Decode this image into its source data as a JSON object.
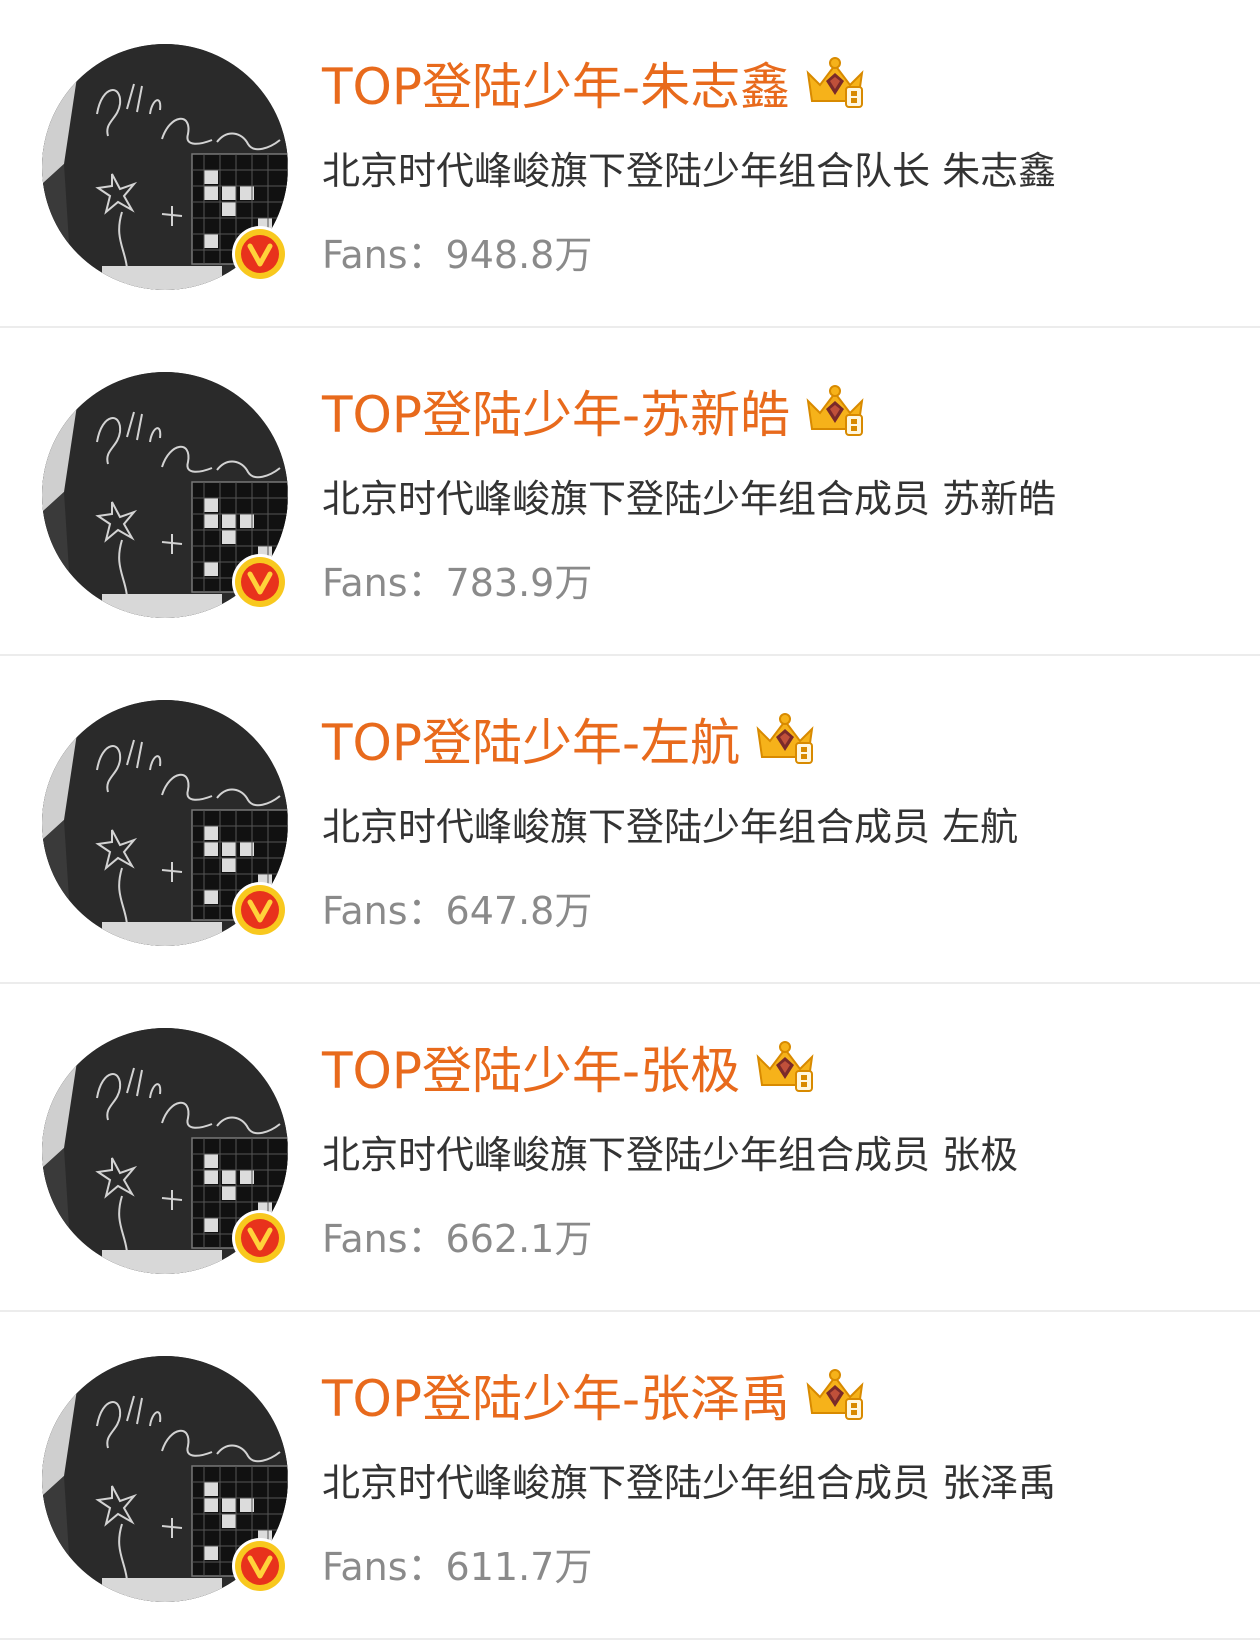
{
  "colors": {
    "name": "#e86a1c",
    "desc": "#333333",
    "fans": "#8a8a8a",
    "divider": "#ececec",
    "badge": "#f5a300"
  },
  "icons": {
    "avatar": "still-alive-album-avatar",
    "verified": "verified-v-badge-icon",
    "crown": "gold-crown-member-icon"
  },
  "accounts": [
    {
      "name": "TOP登陆少年-朱志鑫",
      "desc": "北京时代峰峻旗下登陆少年组合队长 朱志鑫",
      "fans_label": "Fans：",
      "fans_value": "948.8万"
    },
    {
      "name": "TOP登陆少年-苏新皓",
      "desc": "北京时代峰峻旗下登陆少年组合成员 苏新皓",
      "fans_label": "Fans：",
      "fans_value": "783.9万"
    },
    {
      "name": "TOP登陆少年-左航",
      "desc": "北京时代峰峻旗下登陆少年组合成员 左航",
      "fans_label": "Fans：",
      "fans_value": "647.8万"
    },
    {
      "name": "TOP登陆少年-张极",
      "desc": "北京时代峰峻旗下登陆少年组合成员 张极",
      "fans_label": "Fans：",
      "fans_value": "662.1万"
    },
    {
      "name": "TOP登陆少年-张泽禹",
      "desc": "北京时代峰峻旗下登陆少年组合成员 张泽禹",
      "fans_label": "Fans：",
      "fans_value": "611.7万"
    }
  ]
}
